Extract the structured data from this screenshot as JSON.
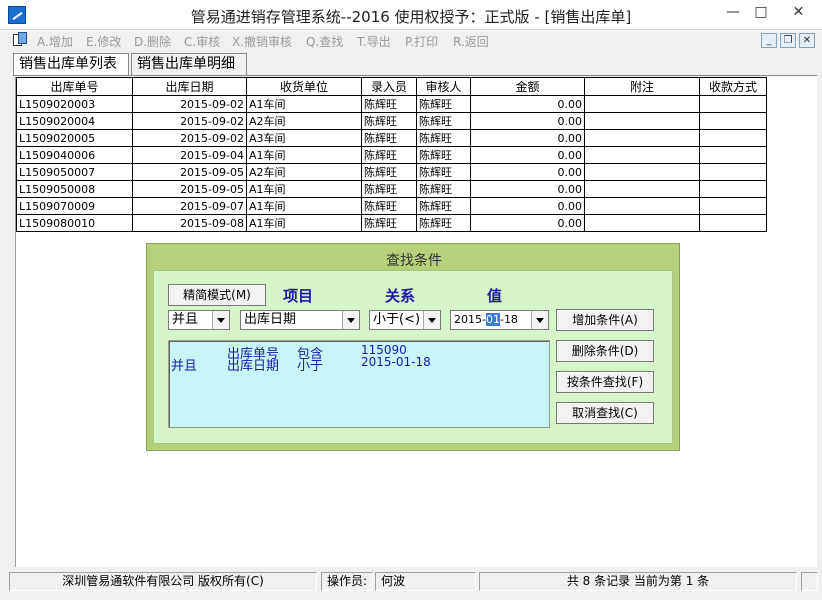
{
  "window": {
    "title": "管易通进销存管理系统--2016 使用权授予：正式版 - [销售出库单]",
    "min_glyph": "—",
    "max_glyph": "□",
    "close_glyph": "✕"
  },
  "toolbar": {
    "items": [
      "A.增加",
      "E.修改",
      "D.删除",
      "C.审核",
      "X.撤销审核",
      "Q.查找",
      "T.导出",
      "P.打印",
      "R.返回"
    ],
    "mdi_min": "_",
    "mdi_restore": "❐",
    "mdi_close": "✕"
  },
  "tabs": [
    "销售出库单列表",
    "销售出库单明细"
  ],
  "table": {
    "columns": [
      "出库单号",
      "出库日期",
      "收货单位",
      "录入员",
      "审核人",
      "金额",
      "附注",
      "收款方式"
    ],
    "rows": [
      [
        "L1509020003",
        "2015-09-02",
        "A1车间",
        "陈辉旺",
        "陈辉旺",
        "0.00",
        "",
        ""
      ],
      [
        "L1509020004",
        "2015-09-02",
        "A2车间",
        "陈辉旺",
        "陈辉旺",
        "0.00",
        "",
        ""
      ],
      [
        "L1509020005",
        "2015-09-02",
        "A3车间",
        "陈辉旺",
        "陈辉旺",
        "0.00",
        "",
        ""
      ],
      [
        "L1509040006",
        "2015-09-04",
        "A1车间",
        "陈辉旺",
        "陈辉旺",
        "0.00",
        "",
        ""
      ],
      [
        "L1509050007",
        "2015-09-05",
        "A2车间",
        "陈辉旺",
        "陈辉旺",
        "0.00",
        "",
        ""
      ],
      [
        "L1509050008",
        "2015-09-05",
        "A1车间",
        "陈辉旺",
        "陈辉旺",
        "0.00",
        "",
        ""
      ],
      [
        "L1509070009",
        "2015-09-07",
        "A1车间",
        "陈辉旺",
        "陈辉旺",
        "0.00",
        "",
        ""
      ],
      [
        "L1509080010",
        "2015-09-08",
        "A1车间",
        "陈辉旺",
        "陈辉旺",
        "0.00",
        "",
        ""
      ]
    ]
  },
  "search": {
    "title": "查找条件",
    "mode_button": "精简模式(M)",
    "header_item": "项目",
    "header_relation": "关系",
    "header_value": "值",
    "logic_value": "并且",
    "field_value": "出库日期",
    "relation_value": "小于(<)",
    "date_pre": "2015-",
    "date_sel": "01",
    "date_post": "-18",
    "add_button": "增加条件(A)",
    "delete_button": "删除条件(D)",
    "search_button": "按条件查找(F)",
    "cancel_button": "取消查找(C)",
    "conditions": [
      {
        "logic": "",
        "field": "出库单号",
        "relation": "包含",
        "value": "115090"
      },
      {
        "logic": "并且",
        "field": "出库日期",
        "relation": "小于",
        "value": "2015-01-18"
      }
    ]
  },
  "status": {
    "company": "深圳管易通软件有限公司 版权所有(C)",
    "operator_label": "操作员:",
    "operator": "何波",
    "records": "共 8 条记录 当前为第 1 条"
  }
}
